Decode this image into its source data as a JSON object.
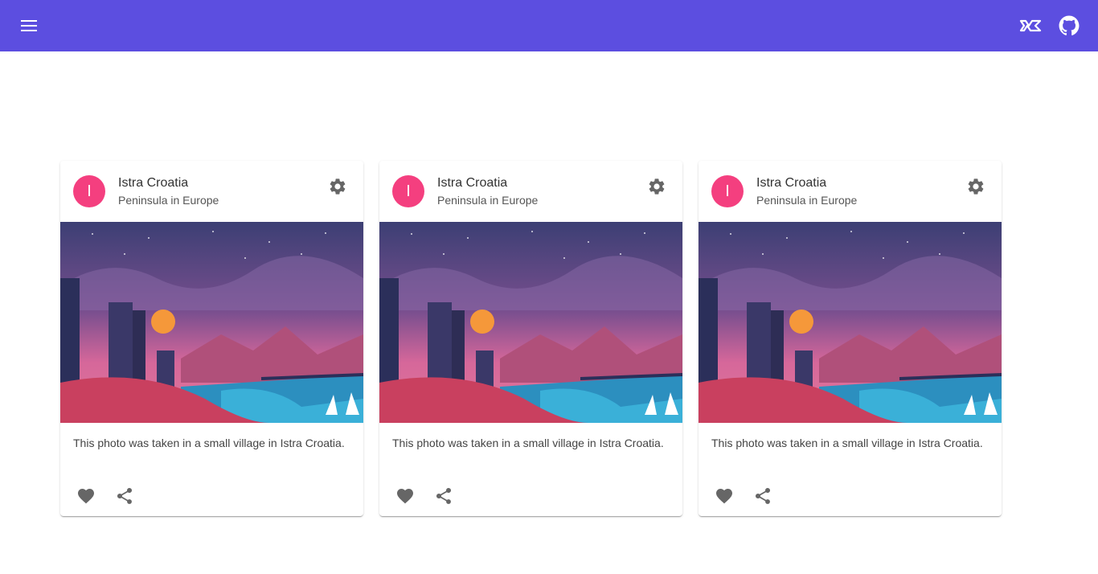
{
  "appbar": {
    "background": "#5c4ee0",
    "menu_icon": "menu-icon",
    "right_icons": [
      "brand-logo-icon",
      "github-icon"
    ]
  },
  "cards": [
    {
      "avatar_letter": "I",
      "avatar_color": "#f43f7f",
      "title": "Istra Croatia",
      "subtitle": "Peninsula in Europe",
      "description": "This photo was taken in a small village in Istra Croatia.",
      "settings_icon": "gear-icon",
      "actions": [
        "heart-icon",
        "share-icon"
      ]
    },
    {
      "avatar_letter": "I",
      "avatar_color": "#f43f7f",
      "title": "Istra Croatia",
      "subtitle": "Peninsula in Europe",
      "description": "This photo was taken in a small village in Istra Croatia.",
      "settings_icon": "gear-icon",
      "actions": [
        "heart-icon",
        "share-icon"
      ]
    },
    {
      "avatar_letter": "I",
      "avatar_color": "#f43f7f",
      "title": "Istra Croatia",
      "subtitle": "Peninsula in Europe",
      "description": "This photo was taken in a small village in Istra Croatia.",
      "settings_icon": "gear-icon",
      "actions": [
        "heart-icon",
        "share-icon"
      ]
    }
  ]
}
